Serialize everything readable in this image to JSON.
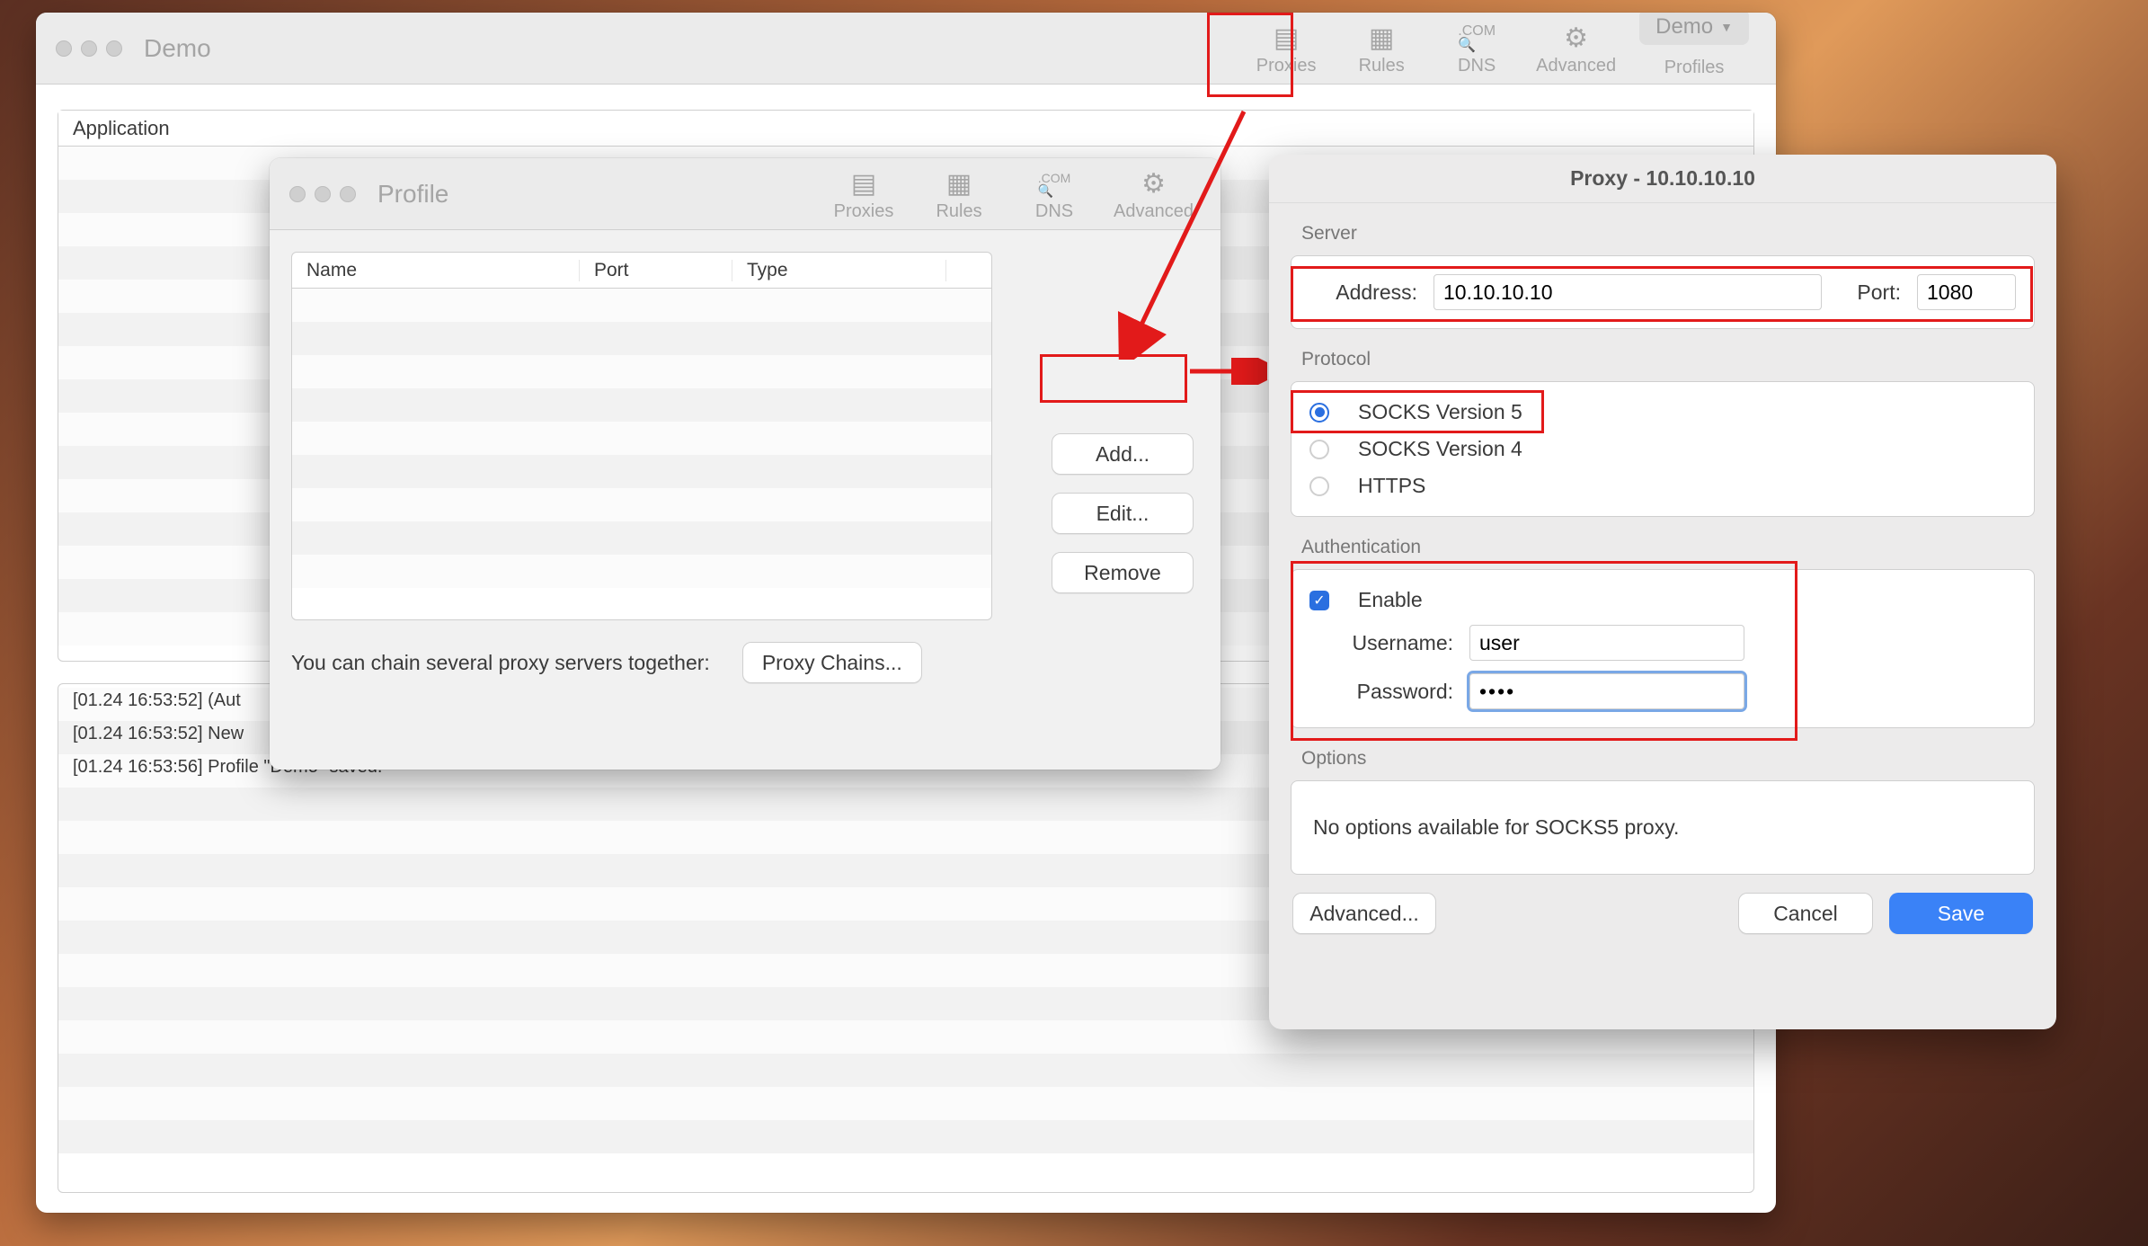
{
  "demo_window": {
    "title": "Demo",
    "toolbar": {
      "items": [
        {
          "label": "Proxies"
        },
        {
          "label": "Rules"
        },
        {
          "label": "DNS"
        },
        {
          "label": "Advanced"
        }
      ],
      "profile_selector": "Demo",
      "profile_selector_hint": "Profiles"
    },
    "table": {
      "header": "Application"
    },
    "log": [
      "[01.24 16:53:52] (Aut",
      "[01.24 16:53:52] New",
      "[01.24 16:53:56] Profile \"Demo\" saved."
    ]
  },
  "profile_window": {
    "title": "Profile",
    "toolbar": {
      "items": [
        {
          "label": "Proxies"
        },
        {
          "label": "Rules"
        },
        {
          "label": "DNS"
        },
        {
          "label": "Advanced"
        }
      ]
    },
    "columns": {
      "name": "Name",
      "port": "Port",
      "type": "Type"
    },
    "buttons": {
      "add": "Add...",
      "edit": "Edit...",
      "remove": "Remove",
      "proxy_chains": "Proxy Chains..."
    },
    "chain_hint": "You can chain several proxy servers together:"
  },
  "proxy_sheet": {
    "title": "Proxy - 10.10.10.10",
    "sections": {
      "server": "Server",
      "protocol": "Protocol",
      "auth": "Authentication",
      "options": "Options"
    },
    "server": {
      "address_label": "Address:",
      "address_value": "10.10.10.10",
      "port_label": "Port:",
      "port_value": "1080"
    },
    "protocol": {
      "socks5": "SOCKS Version 5",
      "socks4": "SOCKS Version 4",
      "https": "HTTPS"
    },
    "auth": {
      "enable_label": "Enable",
      "username_label": "Username:",
      "username_value": "user",
      "password_label": "Password:",
      "password_value": "••••"
    },
    "options_empty": "No options available for SOCKS5 proxy.",
    "footer": {
      "advanced": "Advanced...",
      "cancel": "Cancel",
      "save": "Save"
    }
  }
}
